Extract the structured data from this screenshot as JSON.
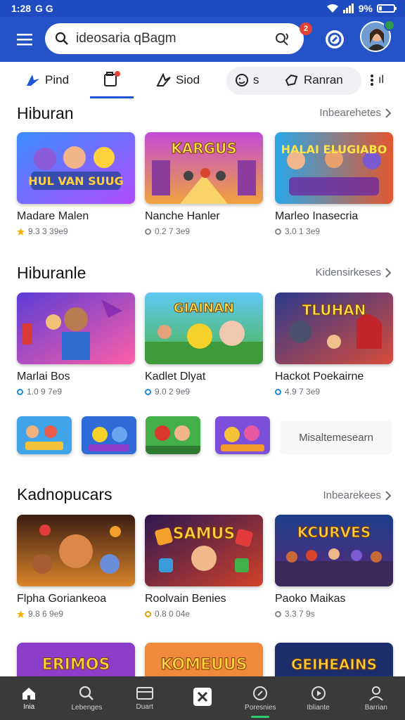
{
  "status": {
    "time": "1:28",
    "icons_left": "G G",
    "battery_text": "9%",
    "battery_level": 0.2
  },
  "search": {
    "placeholder": "ideosaria qBagm",
    "notification_count": "2"
  },
  "tabs": [
    {
      "label": "Pind"
    },
    {
      "label": ""
    },
    {
      "label": "Siod"
    },
    {
      "label": "s"
    },
    {
      "label": "Ranran"
    },
    {
      "label": "ıl"
    }
  ],
  "sections": [
    {
      "title": "Hiburan",
      "link": "Inbearehetes",
      "cards": [
        {
          "title": "Madare Malen",
          "meta": "9.3 3 39e9",
          "art": "HUL VAN SUUG"
        },
        {
          "title": "Nanche Hanler",
          "meta": "0.2 7 3e9",
          "art": "KARGUS"
        },
        {
          "title": "Marleo Inasecria",
          "meta": "3.0 1 3e9",
          "art": "HALAI ELUGIABO"
        }
      ]
    },
    {
      "title": "Hiburanle",
      "link": "Kidensirkeses",
      "cards": [
        {
          "title": "Marlai Bos",
          "meta": "1.0 9 7e9",
          "art": ""
        },
        {
          "title": "Kadlet Dlyat",
          "meta": "9.0 2 9e9",
          "art": "GIAINAN"
        },
        {
          "title": "Hackot Poekairne",
          "meta": "4.9 7 3e9",
          "art": "TLUHAN"
        }
      ]
    },
    {
      "title": "Kadnopucars",
      "link": "Inbearekees",
      "cards": [
        {
          "title": "Flpha Goriankeoa",
          "meta": "9.8 6 9e9",
          "art": ""
        },
        {
          "title": "Roolvain Benies",
          "meta": "0.8 0 04e",
          "art": "SAMUS"
        },
        {
          "title": "Paoko Maikas",
          "meta": "3.3 7 9s",
          "art": "KCURVES"
        }
      ]
    }
  ],
  "more_games": "Misaltemesearn",
  "partial_row": [
    "ERIMOS",
    "KOMEUUS",
    "GEIHEAINS"
  ],
  "bottom_nav": [
    {
      "label": "Inia",
      "icon": "home-icon"
    },
    {
      "label": "Lebenges",
      "icon": "search-icon"
    },
    {
      "label": "Duart",
      "icon": "library-icon"
    },
    {
      "label": "",
      "icon": "games-icon"
    },
    {
      "label": "Poresnies",
      "icon": "compass-icon"
    },
    {
      "label": "Ibliante",
      "icon": "play-icon"
    },
    {
      "label": "Barrian",
      "icon": "profile-icon"
    }
  ],
  "colors": {
    "appbar": "#2453c8",
    "statusbar": "#1e4cc0",
    "accent": "#1a56d6",
    "nav_bg": "#3a3a3a",
    "nav_active": "#2ecc71",
    "star": "#f2b400"
  }
}
